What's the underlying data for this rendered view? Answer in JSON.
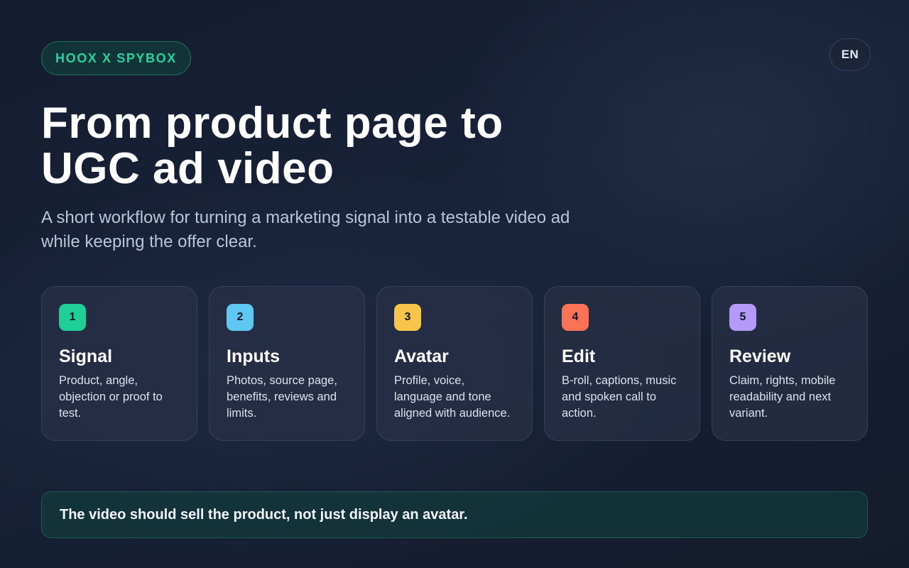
{
  "brand": {
    "label": "HOOX X SPYBOX"
  },
  "language": {
    "label": "EN"
  },
  "hero": {
    "title_lines": [
      "From product page to",
      "UGC ad video"
    ],
    "subtitle_lines": [
      "A short workflow for turning a marketing signal into a testable video ad",
      "while keeping the offer clear."
    ]
  },
  "steps": [
    {
      "number": "1",
      "title": "Signal",
      "text": "Product, angle, objection or proof to test.",
      "color": "#1fcf95"
    },
    {
      "number": "2",
      "title": "Inputs",
      "text": "Photos, source page, benefits, reviews and limits.",
      "color": "#5ec8f2"
    },
    {
      "number": "3",
      "title": "Avatar",
      "text": "Profile, voice, language and tone aligned with audience.",
      "color": "#f7c54a"
    },
    {
      "number": "4",
      "title": "Edit",
      "text": "B-roll, captions, music and spoken call to action.",
      "color": "#fb7257"
    },
    {
      "number": "5",
      "title": "Review",
      "text": "Claim, rights, mobile readability and next variant.",
      "color": "#b49af8"
    }
  ],
  "note": {
    "text": "The video should sell the product, not just display an avatar."
  },
  "colors": {
    "brand_accent": "#27d39c",
    "background": "#161e31",
    "note_background": "#123a3c"
  }
}
